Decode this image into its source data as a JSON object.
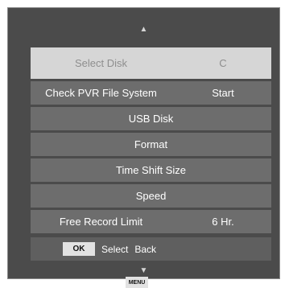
{
  "nav": {
    "up_arrow": "▲",
    "down_arrow": "▼"
  },
  "menu": {
    "items": [
      {
        "label": "Select Disk",
        "value": "C"
      },
      {
        "label": "Check PVR File System",
        "value": "Start"
      },
      {
        "label": "USB Disk"
      },
      {
        "label": "Format"
      },
      {
        "label": "Time Shift Size"
      },
      {
        "label": "Speed"
      },
      {
        "label": "Free Record Limit",
        "value": "6 Hr."
      }
    ]
  },
  "footer": {
    "ok_key": "OK",
    "ok_label": "Select",
    "menu_key": "MENU",
    "menu_label": "Back"
  },
  "colors": {
    "panel": "#4b4b4b",
    "row": "#6d6d6d",
    "selected_row": "#d6d6d6",
    "selected_text": "#8e8e8e"
  }
}
